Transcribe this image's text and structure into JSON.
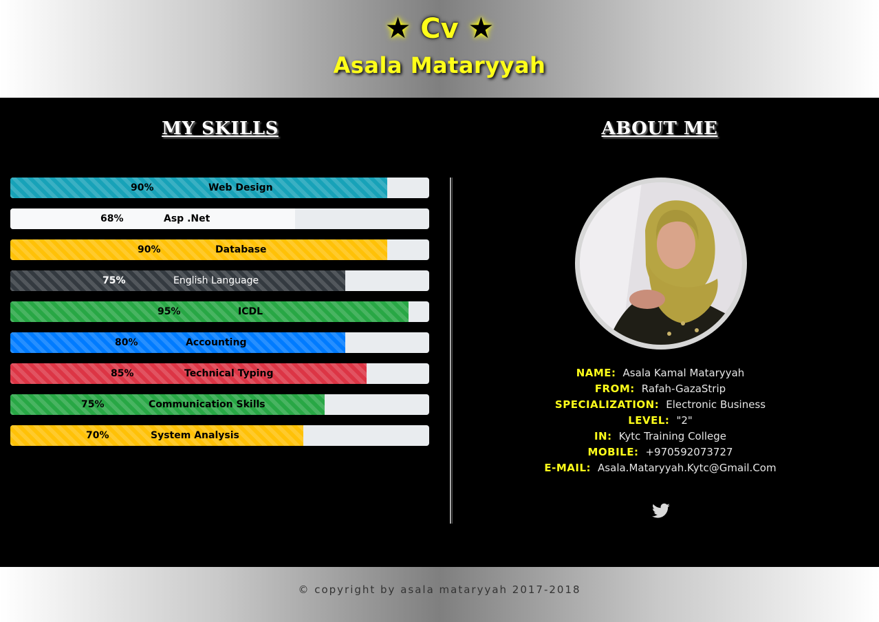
{
  "header": {
    "cv_label": "Cv",
    "name": "Asala Mataryyah",
    "star_icon": "★"
  },
  "skills_title": "MY SKILLS",
  "about_title": "ABOUT ME",
  "skills": [
    {
      "label": "Web Design",
      "percent_text": "90%",
      "level": 0.9,
      "color": "#17a2b8"
    },
    {
      "label": "Asp .Net",
      "percent_text": "68%",
      "level": 0.68,
      "color": "#f8f9fa"
    },
    {
      "label": "Database",
      "percent_text": "90%",
      "level": 0.9,
      "color": "#ffc107"
    },
    {
      "label": "English Language",
      "percent_text": "75%",
      "level": 0.8,
      "color": "#343a40"
    },
    {
      "label": "ICDL",
      "percent_text": "95%",
      "level": 0.95,
      "color": "#28a745"
    },
    {
      "label": "Accounting",
      "percent_text": "80%",
      "level": 0.8,
      "color": "#007bff"
    },
    {
      "label": "Technical Typing",
      "percent_text": "85%",
      "level": 0.85,
      "color": "#dc3545"
    },
    {
      "label": "Communication Skills",
      "percent_text": "75%",
      "level": 0.75,
      "color": "#28a745"
    },
    {
      "label": "System Analysis",
      "percent_text": "70%",
      "level": 0.7,
      "color": "#ffc107"
    }
  ],
  "about": [
    {
      "key": "NAME:",
      "value": "Asala Kamal Mataryyah"
    },
    {
      "key": "FROM:",
      "value": "Rafah-GazaStrip"
    },
    {
      "key": "SPECIALIZATION:",
      "value": "Electronic Business"
    },
    {
      "key": "LEVEL:",
      "value": "\"2\""
    },
    {
      "key": "IN:",
      "value": "Kytc Training College"
    },
    {
      "key": "MOBILE:",
      "value": "+970592073727"
    },
    {
      "key": "E-MAIL:",
      "value": "Asala.Mataryyah.Kytc@Gmail.Com"
    }
  ],
  "social": {
    "icon": "twitter-icon"
  },
  "footer": {
    "copyright": "© copyright by asala mataryyah 2017-2018"
  },
  "colors": {
    "accent_yellow": "#ffff1a",
    "background": "#000000"
  }
}
